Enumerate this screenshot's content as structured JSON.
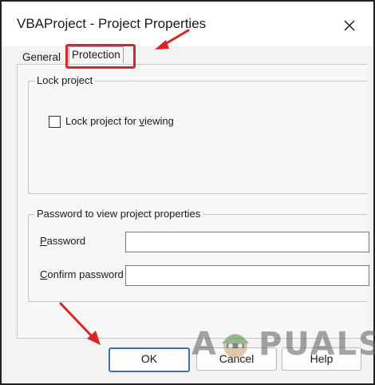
{
  "window": {
    "title": "VBAProject - Project Properties",
    "close_icon": "close-icon"
  },
  "tabs": [
    {
      "label": "General",
      "selected": false
    },
    {
      "label": "Protection",
      "selected": true
    }
  ],
  "lock_project": {
    "legend": "Lock project",
    "checkbox_label": "Lock project for viewing",
    "checked": false
  },
  "password_group": {
    "legend": "Password to view project properties",
    "password_label": "Password",
    "password_value": "",
    "confirm_label": "Confirm password",
    "confirm_value": ""
  },
  "buttons": {
    "ok": "OK",
    "cancel": "Cancel",
    "help": "Help"
  },
  "watermark": {
    "letter": "A",
    "text": "PUALS"
  },
  "colors": {
    "annotation_red": "#d9252a",
    "default_button_border": "#3c6fb8"
  }
}
